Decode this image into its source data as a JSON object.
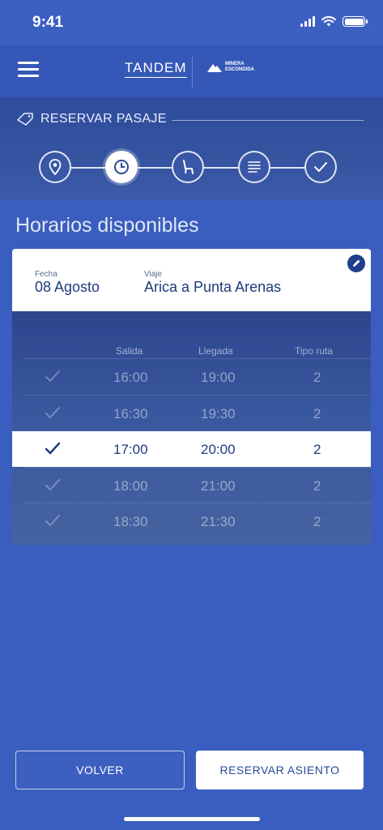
{
  "status_bar": {
    "time": "9:41"
  },
  "header": {
    "logo_tandem": "TANDEM",
    "logo_minera_line1": "MINERA",
    "logo_minera_line2": "ESCONDIDA"
  },
  "section": {
    "title": "RESERVAR PASAJE"
  },
  "stepper": {
    "steps": [
      {
        "icon": "location-pin-icon",
        "state": "done"
      },
      {
        "icon": "clock-icon",
        "state": "active"
      },
      {
        "icon": "seat-icon",
        "state": "pending"
      },
      {
        "icon": "list-icon",
        "state": "pending"
      },
      {
        "icon": "check-icon",
        "state": "pending"
      }
    ]
  },
  "page": {
    "title": "Horarios disponibles"
  },
  "trip": {
    "date_label": "Fecha",
    "date_value": "08 Agosto",
    "route_label": "Viaje",
    "route_value": "Arica a Punta Arenas"
  },
  "schedule": {
    "columns": [
      "Salida",
      "Llegada",
      "Tipo ruta"
    ],
    "rows": [
      {
        "departure": "16:00",
        "arrival": "19:00",
        "route_type": "2",
        "selected": false
      },
      {
        "departure": "16:30",
        "arrival": "19:30",
        "route_type": "2",
        "selected": false
      },
      {
        "departure": "17:00",
        "arrival": "20:00",
        "route_type": "2",
        "selected": true
      },
      {
        "departure": "18:00",
        "arrival": "21:00",
        "route_type": "2",
        "selected": false
      },
      {
        "departure": "18:30",
        "arrival": "21:30",
        "route_type": "2",
        "selected": false
      }
    ]
  },
  "actions": {
    "back_label": "VOLVER",
    "reserve_label": "RESERVAR ASIENTO"
  },
  "colors": {
    "brand_blue": "#3a5ebf",
    "dark_blue": "#1d3b7c",
    "white": "#ffffff"
  }
}
